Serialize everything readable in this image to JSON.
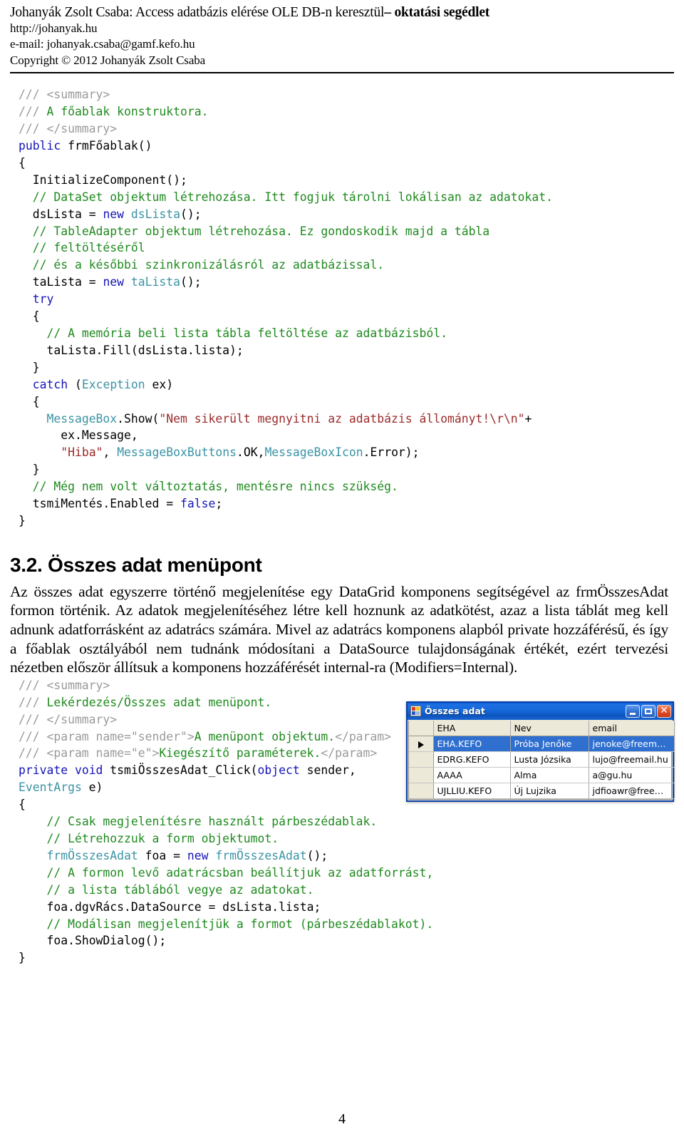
{
  "header": {
    "title_normal": "Johanyák Zsolt Csaba: Access adatbázis elérése OLE DB-n keresztül",
    "title_bold": "– oktatási segédlet",
    "url": "http://johanyak.hu",
    "email": "e-mail: johanyak.csaba@gamf.kefo.hu",
    "copyright": "Copyright © 2012 Johanyák Zsolt Csaba"
  },
  "code_block_1": {
    "lines": [
      [
        {
          "t": "/// <summary>",
          "c": "doc-tag"
        }
      ],
      [
        {
          "t": "/// ",
          "c": "doc-tag"
        },
        {
          "t": "A főablak konstruktora.",
          "c": "cm"
        }
      ],
      [
        {
          "t": "/// </summary>",
          "c": "doc-tag"
        }
      ],
      [
        {
          "t": "public",
          "c": "kw"
        },
        {
          "t": " frmFőablak()",
          "c": ""
        }
      ],
      [
        {
          "t": "{",
          "c": ""
        }
      ],
      [
        {
          "t": "  InitializeComponent();",
          "c": ""
        }
      ],
      [
        {
          "t": "  // DataSet objektum létrehozása. Itt fogjuk tárolni lokálisan az adatokat.",
          "c": "cm"
        }
      ],
      [
        {
          "t": "  dsLista = ",
          "c": ""
        },
        {
          "t": "new",
          "c": "kw"
        },
        {
          "t": " ",
          "c": ""
        },
        {
          "t": "dsLista",
          "c": "ty"
        },
        {
          "t": "();",
          "c": ""
        }
      ],
      [
        {
          "t": "  // TableAdapter objektum létrehozása. Ez gondoskodik majd a tábla",
          "c": "cm"
        }
      ],
      [
        {
          "t": "  // feltöltéséről",
          "c": "cm"
        }
      ],
      [
        {
          "t": "  // és a későbbi szinkronizálásról az adatbázissal.",
          "c": "cm"
        }
      ],
      [
        {
          "t": "  taLista = ",
          "c": ""
        },
        {
          "t": "new",
          "c": "kw"
        },
        {
          "t": " ",
          "c": ""
        },
        {
          "t": "taLista",
          "c": "ty"
        },
        {
          "t": "();",
          "c": ""
        }
      ],
      [
        {
          "t": "  ",
          "c": ""
        },
        {
          "t": "try",
          "c": "kw"
        }
      ],
      [
        {
          "t": "  {",
          "c": ""
        }
      ],
      [
        {
          "t": "    // A memória beli lista tábla feltöltése az adatbázisból.",
          "c": "cm"
        }
      ],
      [
        {
          "t": "    taLista.Fill(dsLista.lista);",
          "c": ""
        }
      ],
      [
        {
          "t": "  }",
          "c": ""
        }
      ],
      [
        {
          "t": "  ",
          "c": ""
        },
        {
          "t": "catch",
          "c": "kw"
        },
        {
          "t": " (",
          "c": ""
        },
        {
          "t": "Exception",
          "c": "ty"
        },
        {
          "t": " ex)",
          "c": ""
        }
      ],
      [
        {
          "t": "  {",
          "c": ""
        }
      ],
      [
        {
          "t": "    ",
          "c": ""
        },
        {
          "t": "MessageBox",
          "c": "ty"
        },
        {
          "t": ".Show(",
          "c": ""
        },
        {
          "t": "\"Nem sikerült megnyitni az adatbázis állományt!\\r\\n\"",
          "c": "str"
        },
        {
          "t": "+",
          "c": ""
        }
      ],
      [
        {
          "t": "      ex.Message,",
          "c": ""
        }
      ],
      [
        {
          "t": "      ",
          "c": ""
        },
        {
          "t": "\"Hiba\"",
          "c": "str"
        },
        {
          "t": ", ",
          "c": ""
        },
        {
          "t": "MessageBoxButtons",
          "c": "ty"
        },
        {
          "t": ".OK,",
          "c": ""
        },
        {
          "t": "MessageBoxIcon",
          "c": "ty"
        },
        {
          "t": ".Error);",
          "c": ""
        }
      ],
      [
        {
          "t": "  }",
          "c": ""
        }
      ],
      [
        {
          "t": "  // Még nem volt változtatás, mentésre nincs szükség.",
          "c": "cm"
        }
      ],
      [
        {
          "t": "  tsmiMentés.Enabled = ",
          "c": ""
        },
        {
          "t": "false",
          "c": "kw"
        },
        {
          "t": ";",
          "c": ""
        }
      ],
      [
        {
          "t": "}",
          "c": ""
        }
      ]
    ]
  },
  "section": {
    "heading": "3.2. Összes adat menüpont",
    "paragraph": "Az összes adat egyszerre történő megjelenítése egy DataGrid komponens segítségével az frmÖsszesAdat formon történik. Az adatok megjelenítéséhez létre kell hoznunk az adatkötést, azaz a lista táblát meg kell adnunk adatforrásként az adatrács számára. Mivel az adatrács komponens alapból private hozzáférésű, és így a főablak osztályából nem tudnánk módosítani a DataSource tulajdonságának értékét, ezért tervezési nézetben először állítsuk a komponens hozzáférését internal-ra (Modifiers=Internal)."
  },
  "code_block_2": {
    "lines": [
      [
        {
          "t": "/// <summary>",
          "c": "doc-tag"
        }
      ],
      [
        {
          "t": "/// ",
          "c": "doc-tag"
        },
        {
          "t": "Lekérdezés/Összes adat menüpont.",
          "c": "cm"
        }
      ],
      [
        {
          "t": "/// </summary>",
          "c": "doc-tag"
        }
      ],
      [
        {
          "t": "/// <param name=\"sender\">",
          "c": "doc-tag"
        },
        {
          "t": "A menüpont objektum.",
          "c": "cm"
        },
        {
          "t": "</param>",
          "c": "doc-tag"
        }
      ],
      [
        {
          "t": "/// <param name=\"e\">",
          "c": "doc-tag"
        },
        {
          "t": "Kiegészítő paraméterek.",
          "c": "cm"
        },
        {
          "t": "</param>",
          "c": "doc-tag"
        }
      ],
      [
        {
          "t": "private",
          "c": "kw"
        },
        {
          "t": " ",
          "c": ""
        },
        {
          "t": "void",
          "c": "kw"
        },
        {
          "t": " tsmiÖsszesAdat_Click(",
          "c": ""
        },
        {
          "t": "object",
          "c": "kw"
        },
        {
          "t": " sender, ",
          "c": ""
        },
        {
          "t": "EventArgs",
          "c": "ty"
        },
        {
          "t": " e)",
          "c": ""
        }
      ],
      [
        {
          "t": "{",
          "c": ""
        }
      ],
      [
        {
          "t": "    // Csak megjelenítésre használt párbeszédablak.",
          "c": "cm"
        }
      ],
      [
        {
          "t": "    // Létrehozzuk a form objektumot.",
          "c": "cm"
        }
      ],
      [
        {
          "t": "    ",
          "c": ""
        },
        {
          "t": "frmÖsszesAdat",
          "c": "ty"
        },
        {
          "t": " foa = ",
          "c": ""
        },
        {
          "t": "new",
          "c": "kw"
        },
        {
          "t": " ",
          "c": ""
        },
        {
          "t": "frmÖsszesAdat",
          "c": "ty"
        },
        {
          "t": "();",
          "c": ""
        }
      ],
      [
        {
          "t": "    // A formon levő adatrácsban beállítjuk az adatforrást,",
          "c": "cm"
        }
      ],
      [
        {
          "t": "    // a lista táblából vegye az adatokat.",
          "c": "cm"
        }
      ],
      [
        {
          "t": "    foa.dgvRács.DataSource = dsLista.lista;",
          "c": ""
        }
      ],
      [
        {
          "t": "    // Modálisan megjelenítjük a formot (párbeszédablakot).",
          "c": "cm"
        }
      ],
      [
        {
          "t": "    foa.ShowDialog();",
          "c": ""
        }
      ],
      [
        {
          "t": "}",
          "c": ""
        }
      ]
    ]
  },
  "dialog": {
    "title": "Összes adat",
    "minimize_label": "Minimize",
    "maximize_label": "Maximize",
    "close_label": "✕",
    "columns": [
      "",
      "EHA",
      "Nev",
      "email"
    ],
    "rows": [
      {
        "marker": "▶",
        "selected": true,
        "cells": [
          "EHA.KEFO",
          "Próba Jenőke",
          "jenoke@freemail...."
        ]
      },
      {
        "marker": "",
        "selected": false,
        "cells": [
          "EDRG.KEFO",
          "Lusta Józsika",
          "lujo@freemail.hu"
        ]
      },
      {
        "marker": "",
        "selected": false,
        "cells": [
          "AAAA",
          "Alma",
          "a@gu.hu"
        ]
      },
      {
        "marker": "",
        "selected": false,
        "cells": [
          "UJLLIU.KEFO",
          "Új Lujzika",
          "jdfioawr@freemail..."
        ]
      }
    ]
  },
  "footer": {
    "page_number": "4"
  },
  "colors": {
    "comment_green": "#1f8a1f",
    "doc_tag_gray": "#9a9a9a",
    "keyword_blue": "#1414b8",
    "type_teal": "#3b93a5",
    "string_red": "#9c2a2a",
    "titlebar_blue": "#1565d8",
    "selection_blue": "#2f6fd0",
    "dialog_face": "#ece9d8"
  }
}
